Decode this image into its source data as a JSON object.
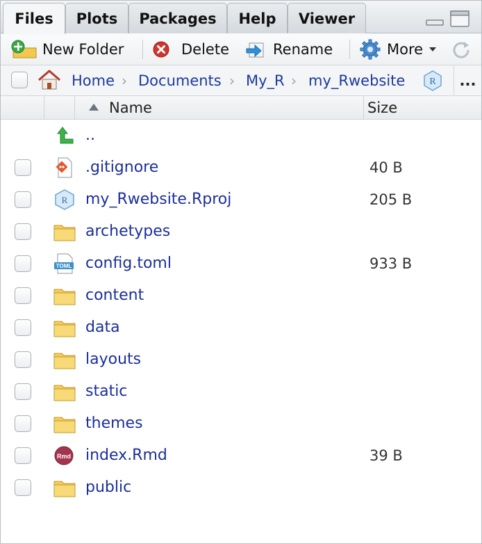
{
  "tabs": [
    {
      "label": "Files",
      "active": true
    },
    {
      "label": "Plots",
      "active": false
    },
    {
      "label": "Packages",
      "active": false
    },
    {
      "label": "Help",
      "active": false
    },
    {
      "label": "Viewer",
      "active": false
    }
  ],
  "toolbar": {
    "new_folder": "New Folder",
    "delete": "Delete",
    "rename": "Rename",
    "more": "More"
  },
  "breadcrumb": [
    "Home",
    "Documents",
    "My_R",
    "my_Rwebsite"
  ],
  "breadcrumb_overflow": "...",
  "header": {
    "name": "Name",
    "size": "Size",
    "sort_icon": "sort-up-triangle"
  },
  "files": [
    {
      "name": "..",
      "size": "",
      "icon": "parent-up-arrow-icon",
      "checkbox": false
    },
    {
      "name": ".gitignore",
      "size": "40 B",
      "icon": "git-file-icon",
      "checkbox": true
    },
    {
      "name": "my_Rwebsite.Rproj",
      "size": "205 B",
      "icon": "rproj-file-icon",
      "checkbox": true
    },
    {
      "name": "archetypes",
      "size": "",
      "icon": "folder-icon",
      "checkbox": true
    },
    {
      "name": "config.toml",
      "size": "933 B",
      "icon": "toml-file-icon",
      "checkbox": true
    },
    {
      "name": "content",
      "size": "",
      "icon": "folder-icon",
      "checkbox": true
    },
    {
      "name": "data",
      "size": "",
      "icon": "folder-icon",
      "checkbox": true
    },
    {
      "name": "layouts",
      "size": "",
      "icon": "folder-icon",
      "checkbox": true
    },
    {
      "name": "static",
      "size": "",
      "icon": "folder-icon",
      "checkbox": true
    },
    {
      "name": "themes",
      "size": "",
      "icon": "folder-icon",
      "checkbox": true
    },
    {
      "name": "index.Rmd",
      "size": "39 B",
      "icon": "rmd-file-icon",
      "checkbox": true
    },
    {
      "name": "public",
      "size": "",
      "icon": "folder-icon",
      "checkbox": true
    }
  ],
  "colors": {
    "link": "#1b2f9a",
    "accent": "#3a7fc1"
  }
}
